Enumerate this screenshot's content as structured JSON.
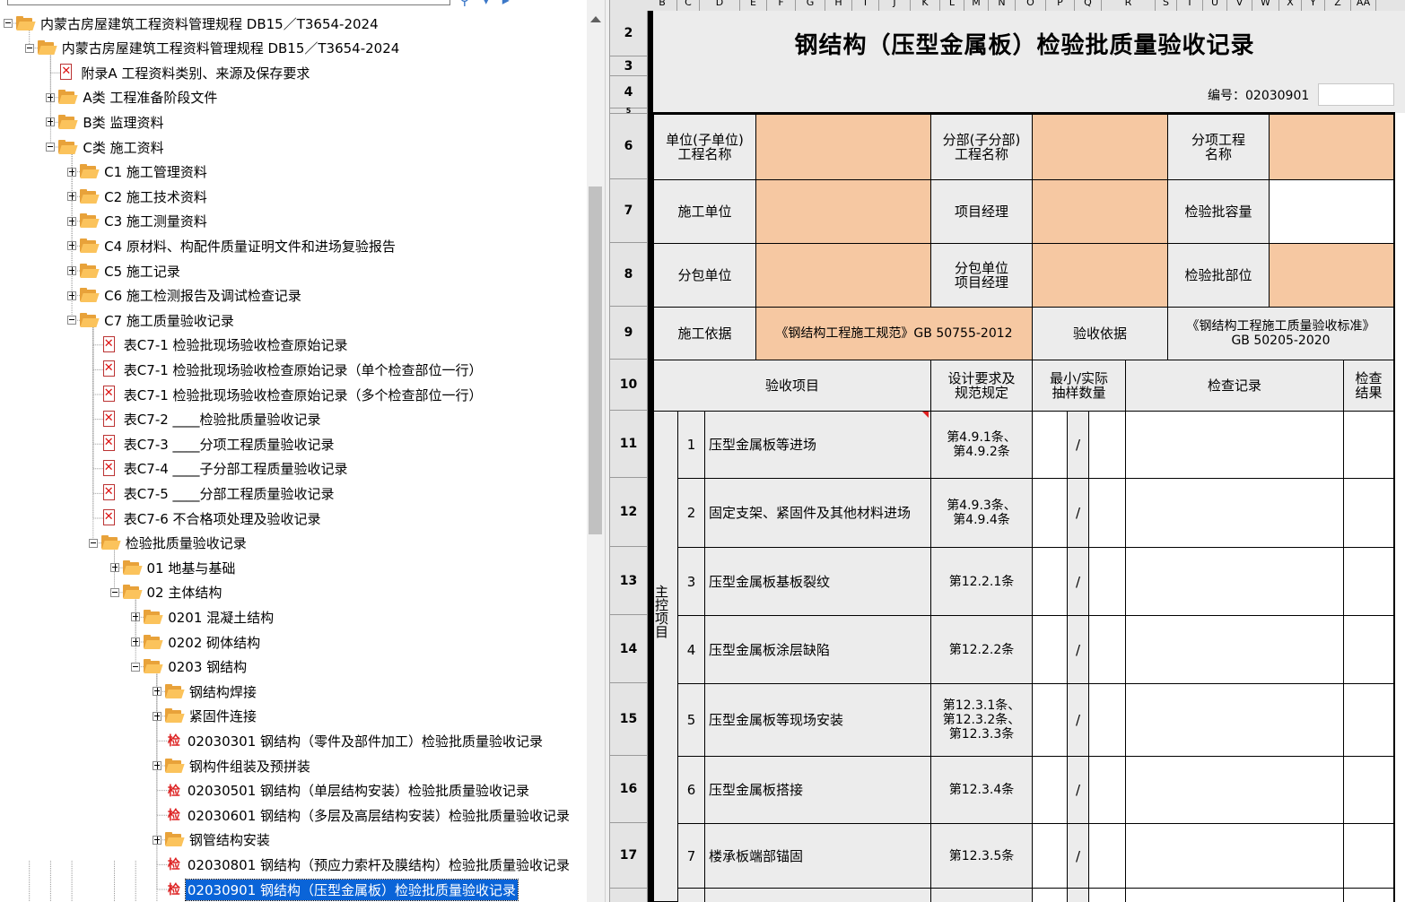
{
  "tree": {
    "nodes": [
      {
        "label": "内蒙古房屋建筑工程资料管理规程 DB15／T3654-2024",
        "icon": "folder-open-icon",
        "expander": "minus"
      },
      {
        "label": "内蒙古房屋建筑工程资料管理规程 DB15／T3654-2024",
        "icon": "folder-open-icon",
        "expander": "minus"
      },
      {
        "label": "附录A  工程资料类别、来源及保存要求",
        "icon": "pdf-doc-icon",
        "expander": ""
      },
      {
        "label": "A类 工程准备阶段文件",
        "icon": "folder-icon",
        "expander": "plus"
      },
      {
        "label": "B类 监理资料",
        "icon": "folder-icon",
        "expander": "plus"
      },
      {
        "label": "C类 施工资料",
        "icon": "folder-open-icon",
        "expander": "minus"
      },
      {
        "label": "C1 施工管理资料",
        "icon": "folder-icon",
        "expander": "plus"
      },
      {
        "label": "C2 施工技术资料",
        "icon": "folder-icon",
        "expander": "plus"
      },
      {
        "label": "C3 施工测量资料",
        "icon": "folder-icon",
        "expander": "plus"
      },
      {
        "label": "C4 原材料、构配件质量证明文件和进场复验报告",
        "icon": "folder-icon",
        "expander": "plus"
      },
      {
        "label": "C5 施工记录",
        "icon": "folder-icon",
        "expander": "plus"
      },
      {
        "label": "C6 施工检测报告及调试检查记录",
        "icon": "folder-icon",
        "expander": "plus"
      },
      {
        "label": "C7 施工质量验收记录",
        "icon": "folder-open-icon",
        "expander": "minus"
      },
      {
        "label": "表C7-1 检验批现场验收检查原始记录",
        "icon": "pdf-doc-icon",
        "expander": ""
      },
      {
        "label": "表C7-1 检验批现场验收检查原始记录（单个检查部位一行）",
        "icon": "pdf-doc-icon",
        "expander": ""
      },
      {
        "label": "表C7-1 检验批现场验收检查原始记录（多个检查部位一行）",
        "icon": "pdf-doc-icon",
        "expander": ""
      },
      {
        "label": "表C7-2 ____检验批质量验收记录",
        "icon": "pdf-doc-icon",
        "expander": ""
      },
      {
        "label": "表C7-3 ____分项工程质量验收记录",
        "icon": "pdf-doc-icon",
        "expander": ""
      },
      {
        "label": "表C7-4 ____子分部工程质量验收记录",
        "icon": "pdf-doc-icon",
        "expander": ""
      },
      {
        "label": "表C7-5 ____分部工程质量验收记录",
        "icon": "pdf-doc-icon",
        "expander": ""
      },
      {
        "label": "表C7-6 不合格项处理及验收记录",
        "icon": "pdf-doc-icon",
        "expander": ""
      },
      {
        "label": "检验批质量验收记录",
        "icon": "folder-open-icon",
        "expander": "minus"
      },
      {
        "label": "01 地基与基础",
        "icon": "folder-icon",
        "expander": "plus"
      },
      {
        "label": "02 主体结构",
        "icon": "folder-open-icon",
        "expander": "minus"
      },
      {
        "label": "0201 混凝土结构",
        "icon": "folder-icon",
        "expander": "plus"
      },
      {
        "label": "0202 砌体结构",
        "icon": "folder-icon",
        "expander": "plus"
      },
      {
        "label": "0203 钢结构",
        "icon": "folder-open-icon",
        "expander": "minus"
      },
      {
        "label": "钢结构焊接",
        "icon": "folder-icon",
        "expander": "plus"
      },
      {
        "label": "紧固件连接",
        "icon": "folder-icon",
        "expander": "plus"
      },
      {
        "label": "02030301 钢结构（零件及部件加工）检验批质量验收记录",
        "icon": "jian-icon",
        "expander": ""
      },
      {
        "label": "钢构件组装及预拼装",
        "icon": "folder-icon",
        "expander": "plus"
      },
      {
        "label": "02030501 钢结构（单层结构安装）检验批质量验收记录",
        "icon": "jian-icon",
        "expander": ""
      },
      {
        "label": "02030601 钢结构（多层及高层结构安装）检验批质量验收记录",
        "icon": "jian-icon",
        "expander": ""
      },
      {
        "label": "钢管结构安装",
        "icon": "folder-icon",
        "expander": "plus"
      },
      {
        "label": "02030801 钢结构（预应力索杆及膜结构）检验批质量验收记录",
        "icon": "jian-icon",
        "expander": ""
      },
      {
        "label": "02030901 钢结构（压型金属板）检验批质量验收记录",
        "icon": "jian-icon",
        "expander": "",
        "selected": true
      }
    ],
    "jian_glyph": "检"
  },
  "sheet": {
    "columns": [
      "B",
      "C",
      "D",
      "E",
      "F",
      "G",
      "H",
      "I",
      "J",
      "K",
      "L",
      "M",
      "N",
      "O",
      "P",
      "Q",
      "R",
      "S",
      "T",
      "U",
      "V",
      "W",
      "X",
      "Y",
      "Z",
      "AA"
    ],
    "rows": [
      "2",
      "3",
      "4",
      "5",
      "6",
      "7",
      "8",
      "9",
      "10",
      "11",
      "12",
      "13",
      "14",
      "15",
      "16",
      "17"
    ],
    "title": "钢结构（压型金属板）检验批质量验收记录",
    "number_label": "编号：02030901",
    "header": {
      "unit_name": "单位(子单位)\n工程名称",
      "division_name": "分部(子分部)\n工程名称",
      "subitem_name": "分项工程\n名称",
      "construction_unit": "施工单位",
      "project_manager": "项目经理",
      "batch_capacity": "检验批容量",
      "sub_unit": "分包单位",
      "sub_unit_manager": "分包单位\n项目经理",
      "batch_location": "检验批部位",
      "construction_basis": "施工依据",
      "construction_basis_value": "《钢结构工程施工规范》GB 50755-2012",
      "acceptance_basis": "验收依据",
      "acceptance_basis_value": "《钢结构工程施工质量验收标准》\nGB 50205-2020"
    },
    "table_header": {
      "item": "验收项目",
      "design": "设计要求及\n规范规定",
      "sample": "最小/实际\n抽样数量",
      "record": "检查记录",
      "result": "检查\n结果"
    },
    "group_label": "主控项目",
    "items": [
      {
        "no": "1",
        "name": "压型金属板等进场",
        "clause": "第4.9.1条、\n第4.9.2条",
        "slash": "/"
      },
      {
        "no": "2",
        "name": "固定支架、紧固件及其他材料进场",
        "clause": "第4.9.3条、\n第4.9.4条",
        "slash": "/"
      },
      {
        "no": "3",
        "name": "压型金属板基板裂纹",
        "clause": "第12.2.1条",
        "slash": "/"
      },
      {
        "no": "4",
        "name": "压型金属板涂层缺陷",
        "clause": "第12.2.2条",
        "slash": "/"
      },
      {
        "no": "5",
        "name": "压型金属板等现场安装",
        "clause": "第12.3.1条、\n第12.3.2条、\n第12.3.3条",
        "slash": "/"
      },
      {
        "no": "6",
        "name": "压型金属板搭接",
        "clause": "第12.3.4条",
        "slash": "/"
      },
      {
        "no": "7",
        "name": "楼承板端部锚固",
        "clause": "第12.3.5条",
        "slash": "/"
      }
    ]
  },
  "colors": {
    "orange_cell": "#f6c8a2",
    "selection": "#0a64d8",
    "folder": "#fbc35c"
  }
}
